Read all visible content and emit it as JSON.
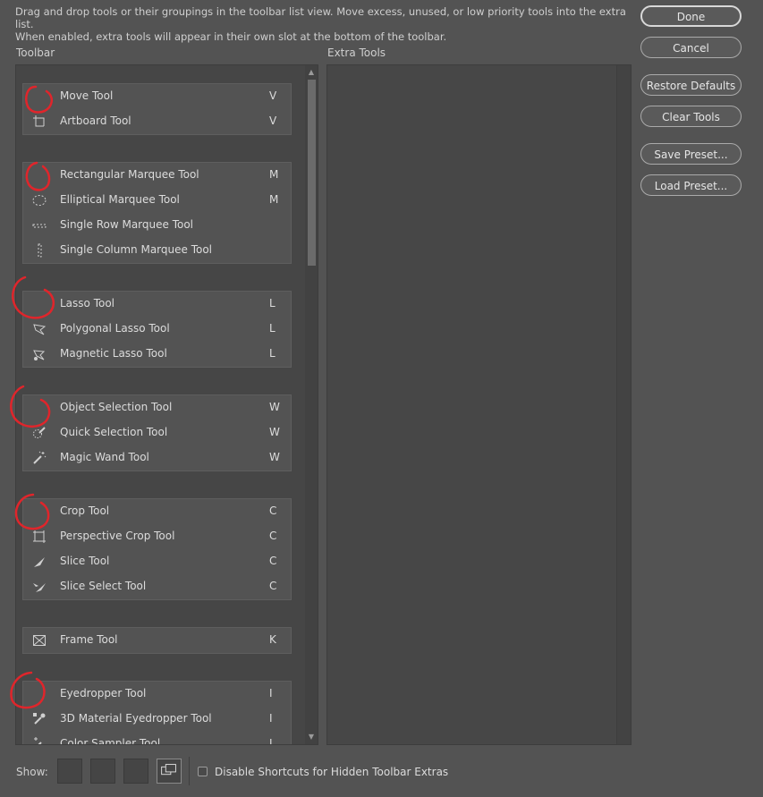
{
  "instructions": {
    "line1": "Drag and drop tools or their groupings in the toolbar list view. Move excess, unused, or low priority tools into the extra list.",
    "line2": "When enabled, extra tools will appear in their own slot at the bottom of the toolbar."
  },
  "toolbar_title": "Toolbar",
  "extra_title": "Extra Tools",
  "buttons": {
    "done": "Done",
    "cancel": "Cancel",
    "restore_defaults": "Restore Defaults",
    "clear_tools": "Clear Tools",
    "save_preset": "Save Preset...",
    "load_preset": "Load Preset..."
  },
  "groups": [
    {
      "tools": [
        {
          "label": "Move Tool",
          "shortcut": "V",
          "icon": "move-icon"
        },
        {
          "label": "Artboard Tool",
          "shortcut": "V",
          "icon": "artboard-icon"
        }
      ]
    },
    {
      "tools": [
        {
          "label": "Rectangular Marquee Tool",
          "shortcut": "M",
          "icon": "rect-marquee-icon"
        },
        {
          "label": "Elliptical Marquee Tool",
          "shortcut": "M",
          "icon": "ellipse-marquee-icon"
        },
        {
          "label": "Single Row Marquee Tool",
          "shortcut": "",
          "icon": "single-row-icon"
        },
        {
          "label": "Single Column Marquee Tool",
          "shortcut": "",
          "icon": "single-column-icon"
        }
      ]
    },
    {
      "tools": [
        {
          "label": "Lasso Tool",
          "shortcut": "L",
          "icon": "lasso-icon"
        },
        {
          "label": "Polygonal Lasso Tool",
          "shortcut": "L",
          "icon": "polygonal-lasso-icon"
        },
        {
          "label": "Magnetic Lasso Tool",
          "shortcut": "L",
          "icon": "magnetic-lasso-icon"
        }
      ]
    },
    {
      "tools": [
        {
          "label": "Object Selection Tool",
          "shortcut": "W",
          "icon": "object-selection-icon"
        },
        {
          "label": "Quick Selection Tool",
          "shortcut": "W",
          "icon": "quick-selection-icon"
        },
        {
          "label": "Magic Wand Tool",
          "shortcut": "W",
          "icon": "magic-wand-icon"
        }
      ]
    },
    {
      "tools": [
        {
          "label": "Crop Tool",
          "shortcut": "C",
          "icon": "crop-icon"
        },
        {
          "label": "Perspective Crop Tool",
          "shortcut": "C",
          "icon": "perspective-crop-icon"
        },
        {
          "label": "Slice Tool",
          "shortcut": "C",
          "icon": "slice-icon"
        },
        {
          "label": "Slice Select Tool",
          "shortcut": "C",
          "icon": "slice-select-icon"
        }
      ]
    },
    {
      "tools": [
        {
          "label": "Frame Tool",
          "shortcut": "K",
          "icon": "frame-icon"
        }
      ]
    },
    {
      "tools": [
        {
          "label": "Eyedropper Tool",
          "shortcut": "I",
          "icon": "eyedropper-icon"
        },
        {
          "label": "3D Material Eyedropper Tool",
          "shortcut": "I",
          "icon": "material-eyedropper-icon"
        },
        {
          "label": "Color Sampler Tool",
          "shortcut": "I",
          "icon": "color-sampler-icon"
        }
      ]
    }
  ],
  "footer": {
    "show_label": "Show:",
    "disable_shortcuts_label": "Disable Shortcuts for Hidden Toolbar Extras",
    "disable_shortcuts_checked": false
  },
  "colors": {
    "background": "#535353",
    "panel": "#464646",
    "annotation": "#e0252b"
  }
}
